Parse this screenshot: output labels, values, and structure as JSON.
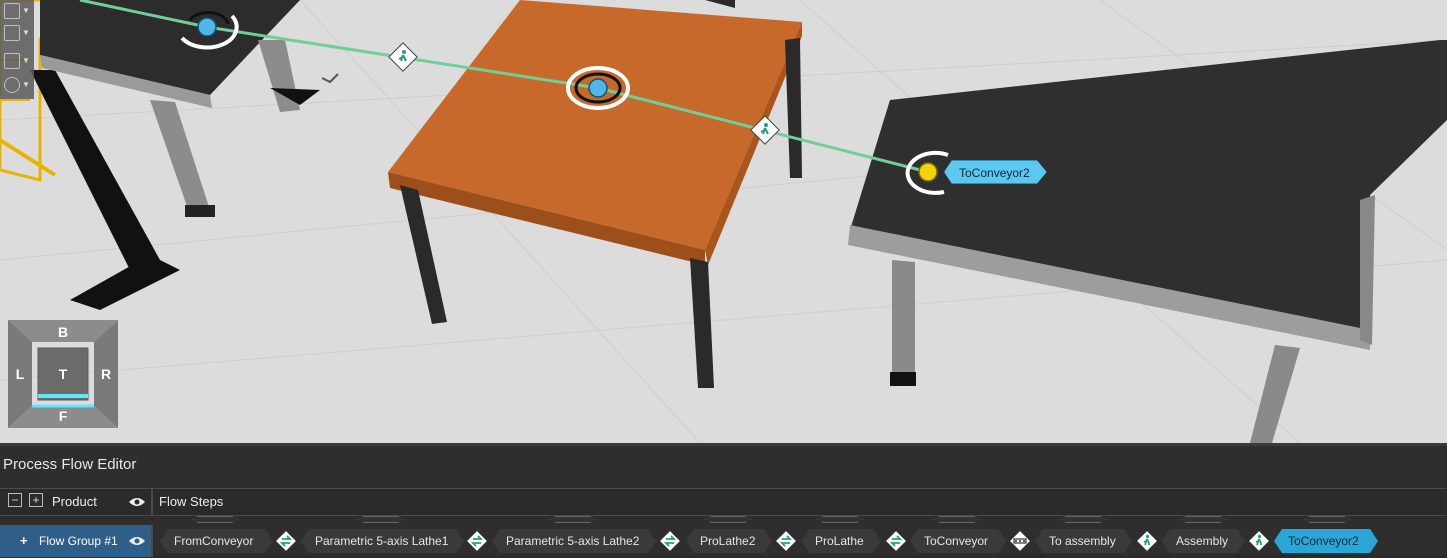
{
  "viewport": {
    "point_label": "ToConveyor2",
    "view_cube": {
      "back": "B",
      "left": "L",
      "top": "T",
      "right": "R",
      "front": "F"
    }
  },
  "pfe": {
    "title": "Process Flow Editor",
    "product_label": "Product",
    "flow_steps_label": "Flow Steps",
    "collapse_label": "−",
    "expand_label": "+",
    "flow_group": {
      "plus": "+",
      "label": "Flow Group #1"
    },
    "steps": [
      {
        "label": "FromConveyor",
        "selected": false
      },
      {
        "label": "Parametric 5-axis Lathe1",
        "selected": false
      },
      {
        "label": "Parametric 5-axis Lathe2",
        "selected": false
      },
      {
        "label": "ProLathe2",
        "selected": false
      },
      {
        "label": "ProLathe",
        "selected": false
      },
      {
        "label": "ToConveyor",
        "selected": false
      },
      {
        "label": "To assembly",
        "selected": false
      },
      {
        "label": "Assembly",
        "selected": false
      },
      {
        "label": "ToConveyor2",
        "selected": true
      }
    ],
    "connectors": [
      {
        "icon": "transfer-icon"
      },
      {
        "icon": "transfer-icon"
      },
      {
        "icon": "transfer-icon"
      },
      {
        "icon": "transfer-icon"
      },
      {
        "icon": "transfer-icon"
      },
      {
        "icon": "conveyor-icon"
      },
      {
        "icon": "human-walk-icon"
      },
      {
        "icon": "human-walk-icon"
      }
    ]
  },
  "colors": {
    "accent": "#2aa6d6",
    "flow_line": "#6fcf97",
    "point_blue": "#4fb8e8",
    "point_yellow": "#f2d40a",
    "flow_group_bg": "#2f5f88"
  }
}
